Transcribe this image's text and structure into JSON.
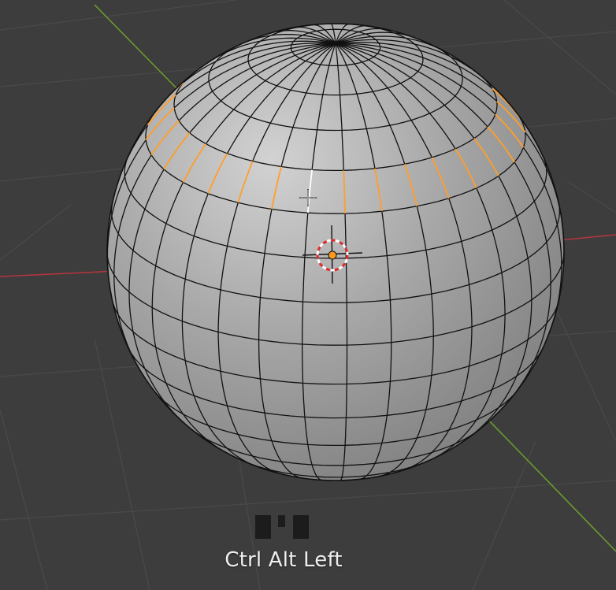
{
  "viewport": {
    "background_color": "#3d3d3d",
    "grid_color": "#4a4a4a",
    "axis_x_color": "#b3353f",
    "axis_y_color": "#6c9b2d"
  },
  "mesh": {
    "object": "uv-sphere",
    "face_color": "#a9a9a9",
    "edge_color": "#111111",
    "selected_edge_color": "#ff9e2a",
    "active_edge_color": "#ffffff"
  },
  "cursor_3d": {
    "ring_colors": [
      "#e02a2a",
      "#ffffff"
    ],
    "origin_color": "#ff9a1f"
  },
  "keycast": {
    "mouse_icon": "mouse-left-button-icon",
    "label": "Ctrl Alt Left"
  }
}
